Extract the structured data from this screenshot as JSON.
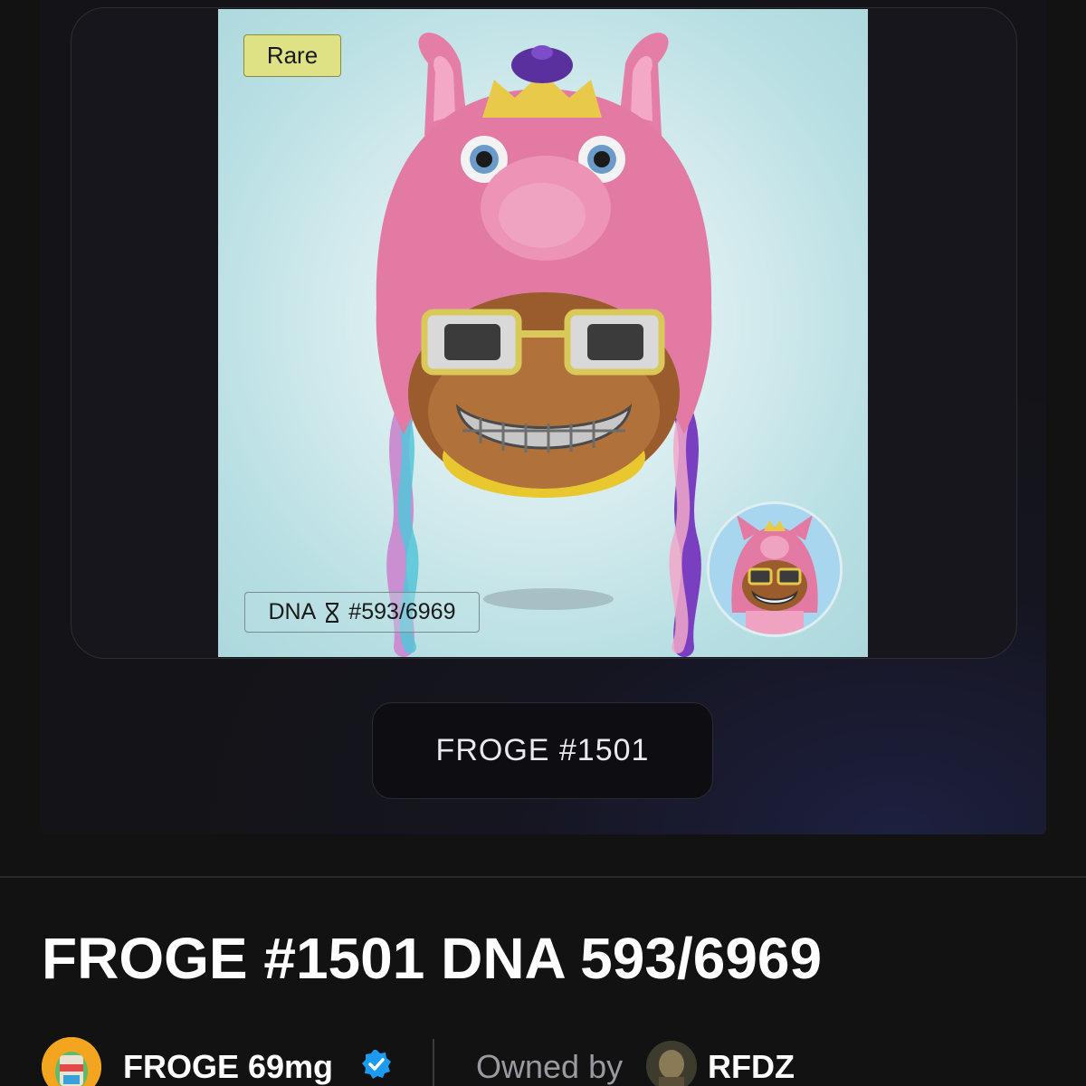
{
  "artwork": {
    "rarity_badge": "Rare",
    "dna_prefix": "DNA",
    "dna_icon": "dna-helix-icon",
    "dna_number": "#593/6969"
  },
  "token_name_button": "FROGE #1501",
  "title": "FROGE #1501 DNA 593/6969",
  "collection": {
    "name": "FROGE 69mg",
    "verified_icon": "verified-check-icon",
    "verified_color": "#1d9bf0"
  },
  "owner": {
    "label": "Owned by",
    "name": "RFDZ"
  },
  "colors": {
    "background": "#121212",
    "rarity_badge": "#dfe284",
    "artwork_bg": "#b8dfe3"
  }
}
